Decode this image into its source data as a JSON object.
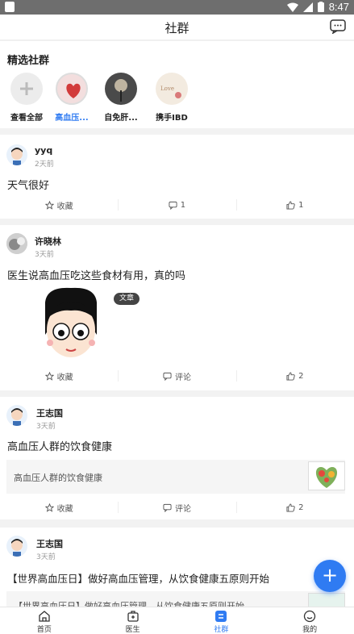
{
  "status_bar": {
    "time": "8:47"
  },
  "header": {
    "title": "社群"
  },
  "featured": {
    "title": "精选社群",
    "groups": [
      {
        "label": "查看全部",
        "active": false
      },
      {
        "label": "高血压...",
        "active": true
      },
      {
        "label": "自免肝...",
        "active": false
      },
      {
        "label": "携手IBD",
        "active": false
      }
    ]
  },
  "posts": [
    {
      "user": "yyq",
      "time": "2天前",
      "title": "天气很好",
      "actions": {
        "collect": "收藏",
        "comment": "1",
        "like": "1"
      }
    },
    {
      "user": "许晓林",
      "time": "3天前",
      "title": "医生说高血压吃这些食材有用，真的吗",
      "badge": "文章",
      "actions": {
        "collect": "收藏",
        "comment": "评论",
        "like": "2"
      }
    },
    {
      "user": "王志国",
      "time": "3天前",
      "title": "高血压人群的饮食健康",
      "article": "高血压人群的饮食健康",
      "actions": {
        "collect": "收藏",
        "comment": "评论",
        "like": "2"
      }
    },
    {
      "user": "王志国",
      "time": "3天前",
      "title": "【世界高血压日】做好高血压管理，从饮食健康五原则开始",
      "article": "【世界高血压日】做好高血压管理，从饮食健康五原则开始"
    }
  ],
  "tabbar": [
    {
      "label": "首页",
      "active": false
    },
    {
      "label": "医生",
      "active": false
    },
    {
      "label": "社群",
      "active": true
    },
    {
      "label": "我的",
      "active": false
    }
  ],
  "colors": {
    "accent": "#2f7bf2"
  }
}
